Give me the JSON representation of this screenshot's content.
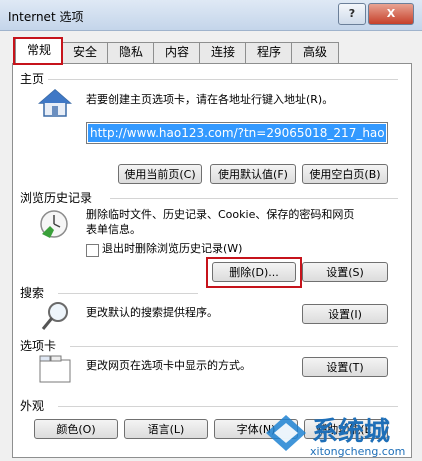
{
  "window": {
    "title": "Internet 选项",
    "help_label": "?",
    "close_label": "X"
  },
  "tabs": [
    "常规",
    "安全",
    "隐私",
    "内容",
    "连接",
    "程序",
    "高级"
  ],
  "home": {
    "section": "主页",
    "desc": "若要创建主页选项卡，请在各地址行键入地址(R)。",
    "url": "http://www.hao123.com/?tn=29065018_217_hao",
    "buttons": [
      "使用当前页(C)",
      "使用默认值(F)",
      "使用空白页(B)"
    ]
  },
  "history": {
    "section": "浏览历史记录",
    "desc_line1": "删除临时文件、历史记录、Cookie、保存的密码和网页",
    "desc_line2": "表单信息。",
    "checkbox_label": "退出时删除浏览历史记录(W)",
    "delete_label": "删除(D)...",
    "settings_label": "设置(S)"
  },
  "search": {
    "section": "搜索",
    "desc": "更改默认的搜索提供程序。",
    "settings_label": "设置(I)"
  },
  "tabs_section": {
    "section": "选项卡",
    "desc": "更改网页在选项卡中显示的方式。",
    "settings_label": "设置(T)"
  },
  "appearance": {
    "section": "外观",
    "buttons": [
      "颜色(O)",
      "语言(L)",
      "字体(N)",
      "辅助功能(E)"
    ]
  },
  "watermark": {
    "brand": "系统城",
    "site": "xitongcheng.com"
  }
}
